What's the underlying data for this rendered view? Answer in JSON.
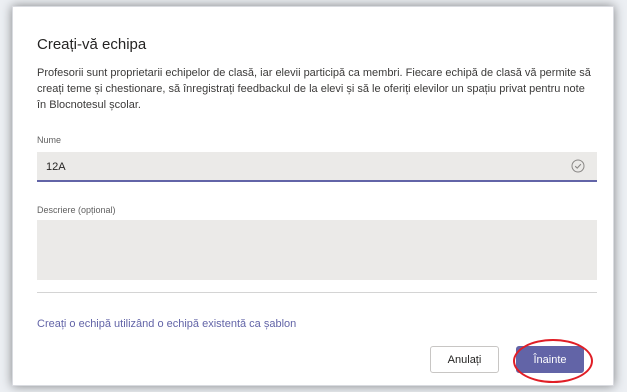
{
  "dialog": {
    "title": "Creați-vă echipa",
    "description": "Profesorii sunt proprietarii echipelor de clasă, iar elevii participă ca membri. Fiecare echipă de clasă vă permite să creați teme și chestionare, să înregistrați feedbackul de la elevi și să le oferiți elevilor un spațiu privat pentru note în Blocnotesul școlar."
  },
  "form": {
    "name_label": "Nume",
    "name_value": "12A",
    "description_label": "Descriere (opțional)",
    "description_value": ""
  },
  "template_link": "Creați o echipă utilizând o echipă existentă ca șablon",
  "buttons": {
    "cancel": "Anulați",
    "next": "Înainte"
  },
  "colors": {
    "accent": "#6264a7",
    "highlight": "#e01e26"
  }
}
